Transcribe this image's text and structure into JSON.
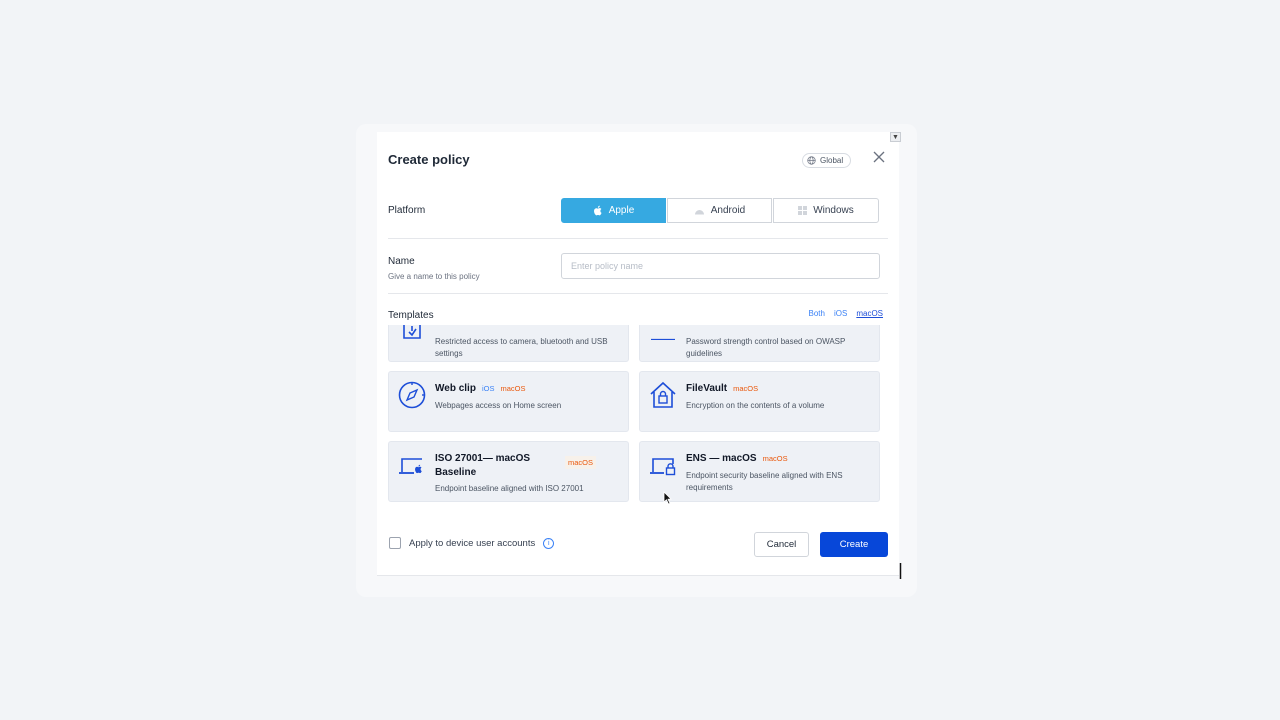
{
  "dialog": {
    "title": "Create policy",
    "scope_label": "Global"
  },
  "platform": {
    "label": "Platform",
    "options": [
      {
        "label": "Apple",
        "selected": true
      },
      {
        "label": "Android",
        "selected": false
      },
      {
        "label": "Windows",
        "selected": false
      }
    ]
  },
  "name_field": {
    "label": "Name",
    "hint": "Give a name to this policy",
    "value": "",
    "placeholder": "Enter policy name"
  },
  "templates": {
    "label": "Templates",
    "filters": [
      {
        "label": "Both",
        "selected": false
      },
      {
        "label": "iOS",
        "selected": false
      },
      {
        "label": "macOS",
        "selected": true
      }
    ],
    "cards": [
      {
        "title": "",
        "desc": "Restricted access to camera, bluetooth and USB settings",
        "icon": "restriction-icon",
        "tags": []
      },
      {
        "title": "",
        "desc": "Password strength control based on OWASP guidelines",
        "icon": "password-icon",
        "tags": []
      },
      {
        "title": "Web clip",
        "desc": "Webpages access on Home screen",
        "icon": "compass-icon",
        "tags": [
          "iOS",
          "macOS"
        ]
      },
      {
        "title": "FileVault",
        "desc": "Encryption on the contents of a volume",
        "icon": "house-lock-icon",
        "tags": [
          "macOS"
        ]
      },
      {
        "title": "ISO 27001— macOS Baseline",
        "desc": "Endpoint baseline aligned with ISO 27001",
        "icon": "laptop-apple-icon",
        "tags": [
          "macOS"
        ]
      },
      {
        "title": "ENS — macOS",
        "desc": "Endpoint security baseline aligned with ENS requirements",
        "icon": "laptop-lock-icon",
        "tags": [
          "macOS"
        ]
      }
    ]
  },
  "footer": {
    "apply_label": "Apply to device user accounts",
    "apply_checked": false,
    "cancel_label": "Cancel",
    "create_label": "Create"
  },
  "colors": {
    "accent": "#36a9e1",
    "primary": "#0747d9",
    "icon_blue": "#1d4ed8",
    "macos_tag": "#ea580c",
    "ios_tag": "#3b82f6"
  }
}
